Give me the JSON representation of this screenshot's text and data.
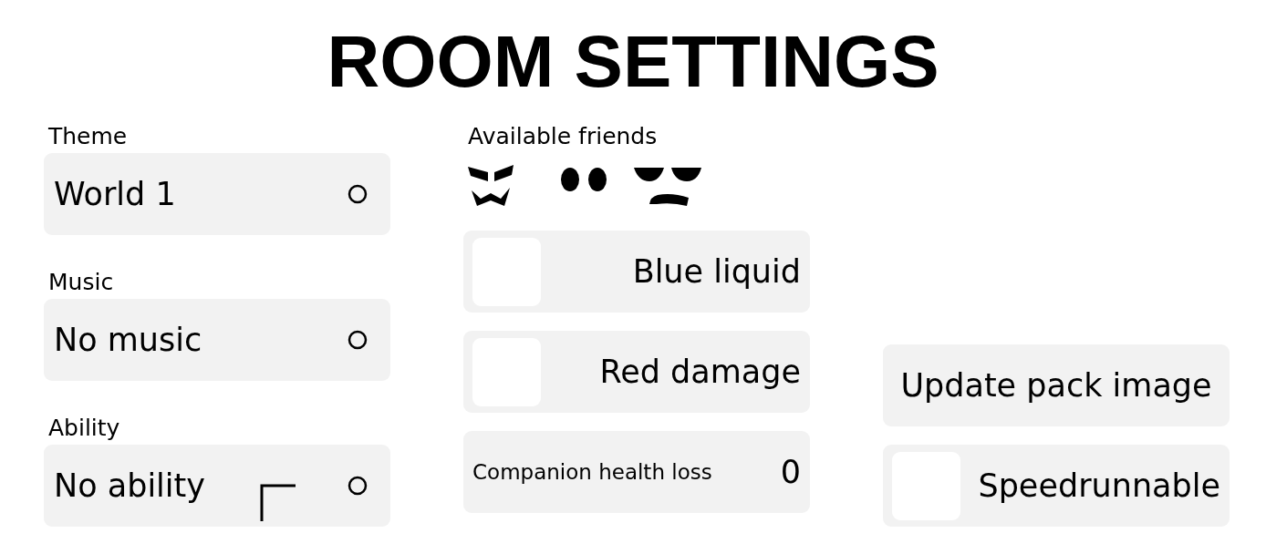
{
  "title": "ROOM SETTINGS",
  "dropdowns": [
    {
      "label": "Theme",
      "value": "World 1"
    },
    {
      "label": "Music",
      "value": "No music"
    },
    {
      "label": "Ability",
      "value": "No ability"
    }
  ],
  "friends": {
    "label": "Available friends"
  },
  "options": [
    {
      "kind": "checkbox",
      "label": "Blue liquid",
      "checked": false
    },
    {
      "kind": "checkbox",
      "label": "Red damage",
      "checked": false
    },
    {
      "kind": "number",
      "label": "Companion health loss",
      "value": "0"
    }
  ],
  "pack": [
    {
      "kind": "button",
      "label": "Update pack image"
    },
    {
      "kind": "checkbox",
      "label": "Speedrunnable",
      "checked": false
    }
  ]
}
